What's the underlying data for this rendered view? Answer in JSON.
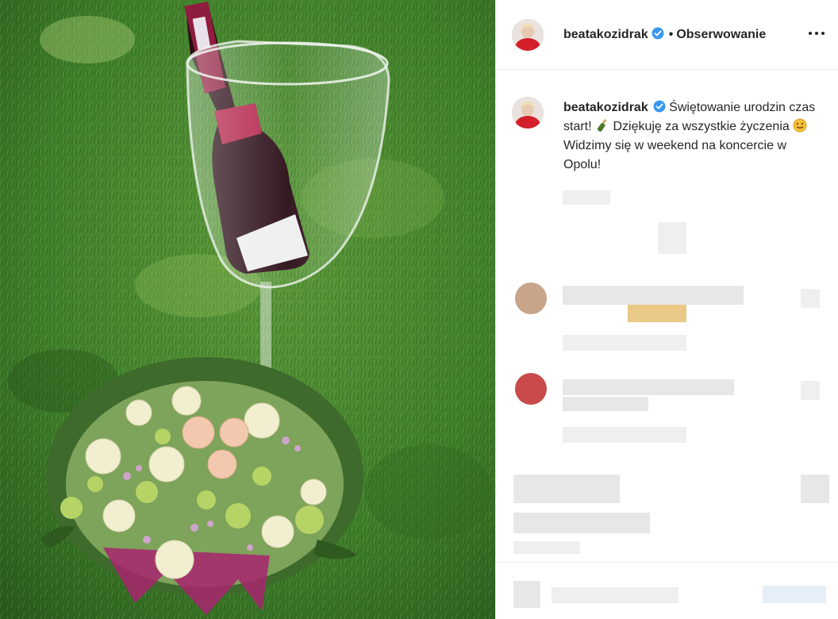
{
  "post": {
    "username": "beatakozidrak",
    "follow_dot": "•",
    "follow_label": "Obserwowanie",
    "more_icon": "more-horizontal-icon",
    "verified_icon": "verified-badge-icon",
    "caption_part1": "Świętowanie urodzin czas start!",
    "caption_part2": "Dziękuję za wszystkie życzenia",
    "caption_part3": "Widzimy się w weekend na koncercie w Opolu!",
    "caption_emoji1": "bottle-with-popping-cork-emoji",
    "caption_emoji2": "smiling-face-emoji"
  },
  "colors": {
    "verified_blue": "#3897f0",
    "grass_dark": "#2f6a23",
    "grass_light": "#5c9a3a",
    "wine_label": "#b3224a"
  }
}
